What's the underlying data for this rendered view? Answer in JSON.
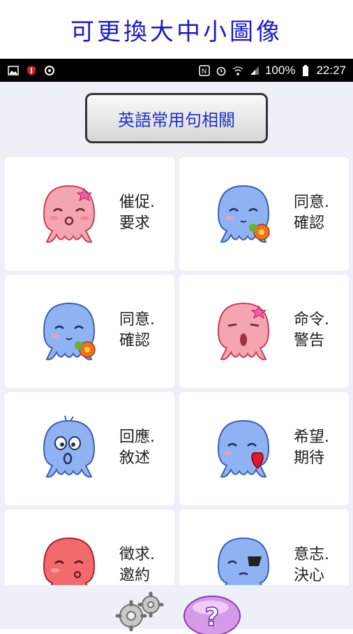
{
  "banner": {
    "title": "可更換大中小圖像"
  },
  "status_bar": {
    "battery": "100%",
    "time": "22:27"
  },
  "header": {
    "button_label": "英語常用句相關"
  },
  "colors": {
    "pink": "#f4a5b0",
    "blue": "#8fb3f2",
    "red": "#f26b6b",
    "accent_text": "#2233cc"
  },
  "cards": [
    {
      "line1": "催促.",
      "line2": "要求",
      "avatar": "pink-octopus-wink-icon"
    },
    {
      "line1": "同意.",
      "line2": "確認",
      "avatar": "blue-octopus-flower-icon"
    },
    {
      "line1": "同意.",
      "line2": "確認",
      "avatar": "blue-octopus-flower-icon"
    },
    {
      "line1": "命令.",
      "line2": "警告",
      "avatar": "pink-octopus-shout-icon"
    },
    {
      "line1": "回應.",
      "line2": "敘述",
      "avatar": "blue-octopus-surprised-icon"
    },
    {
      "line1": "希望.",
      "line2": "期待",
      "avatar": "blue-octopus-heart-icon"
    },
    {
      "line1": "徵求.",
      "line2": "邀約",
      "avatar": "red-octopus-kiss-icon"
    },
    {
      "line1": "意志.",
      "line2": "決心",
      "avatar": "blue-octopus-eyepatch-icon"
    }
  ],
  "bottom": {
    "settings_icon": "gears-icon",
    "help_icon": "question-mark-icon"
  }
}
